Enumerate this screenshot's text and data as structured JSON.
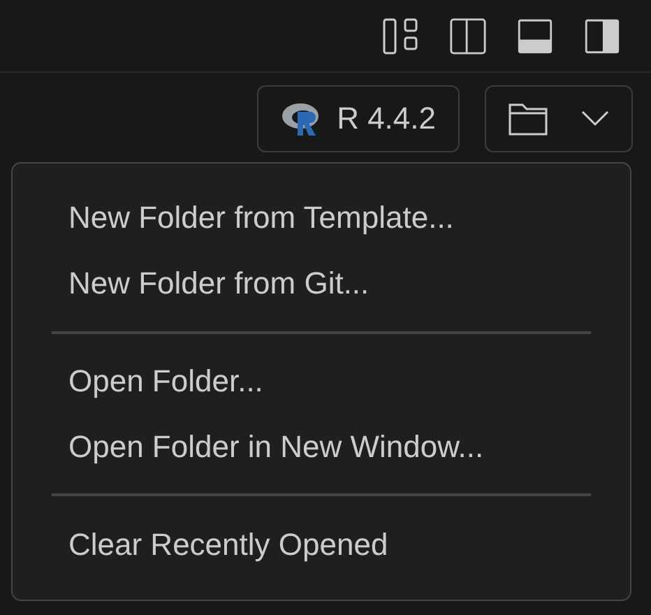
{
  "toolbar": {
    "layout_buttons": [
      {
        "kind": "customize"
      },
      {
        "kind": "sidebar"
      },
      {
        "kind": "panel"
      },
      {
        "kind": "secondary"
      }
    ]
  },
  "r_version": {
    "label": "R 4.4.2"
  },
  "menu": {
    "items": [
      {
        "kind": "item",
        "label": "New Folder from Template..."
      },
      {
        "kind": "item",
        "label": "New Folder from Git..."
      },
      {
        "kind": "separator"
      },
      {
        "kind": "item",
        "label": "Open Folder..."
      },
      {
        "kind": "item",
        "label": "Open Folder in New Window..."
      },
      {
        "kind": "separator"
      },
      {
        "kind": "item",
        "label": "Clear Recently Opened"
      }
    ]
  }
}
